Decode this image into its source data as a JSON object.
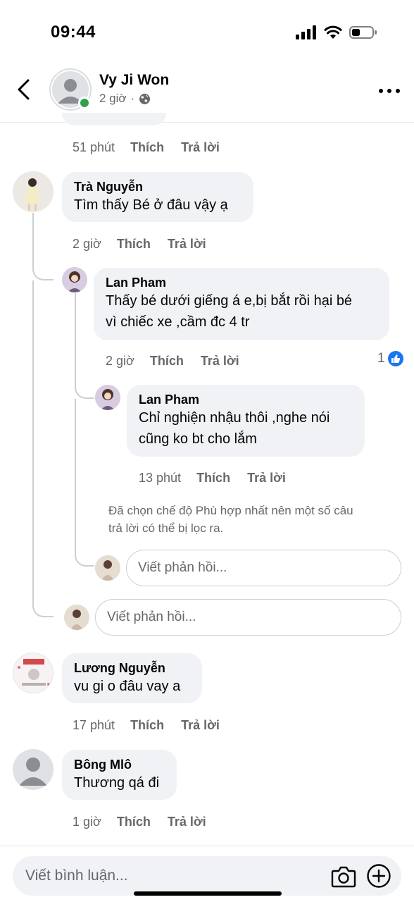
{
  "status_bar": {
    "time": "09:44"
  },
  "header": {
    "name": "Vy Ji Won",
    "time": "2 giờ",
    "separator": "·"
  },
  "comments": [
    {
      "time": "51 phút",
      "like": "Thích",
      "reply": "Trả lời"
    },
    {
      "name": "Trà Nguyễn",
      "text": "Tìm thấy Bé ở đâu vậy ạ",
      "time": "2 giờ",
      "like": "Thích",
      "reply": "Trả lời"
    },
    {
      "name": "Lan Pham",
      "text_line1": "Thấy bé dưới giếng á e,bị bắt rồi hại bé",
      "text_line2": "vì chiếc xe ,cầm đc 4 tr",
      "time": "2 giờ",
      "like": "Thích",
      "reply": "Trả lời",
      "reactions": "1"
    },
    {
      "name": "Lan Pham",
      "text_line1": "Chỉ nghiện nhậu thôi ,nghe nói",
      "text_line2": "cũng ko bt cho lắm",
      "time": "13 phút",
      "like": "Thích",
      "reply": "Trả lời"
    },
    {
      "name": "Lương Nguyễn",
      "text": "vu gi o đâu vay a",
      "time": "17 phút",
      "like": "Thích",
      "reply": "Trả lời"
    },
    {
      "name": "Bông Mlô",
      "text": "Thương qá đi",
      "time": "1 giờ",
      "like": "Thích",
      "reply": "Trả lời"
    }
  ],
  "filter_note_line1": "Đã chọn chế độ Phù hợp nhất nên một số câu",
  "filter_note_line2": "trả lời có thể bị lọc ra.",
  "reply_placeholder": "Viết phản hồi...",
  "comment_placeholder": "Viết bình luận...",
  "colors": {
    "like_blue": "#1877f2",
    "online_green": "#31a24c",
    "bubble_bg": "#f0f2f5",
    "secondary_text": "#65676b"
  }
}
